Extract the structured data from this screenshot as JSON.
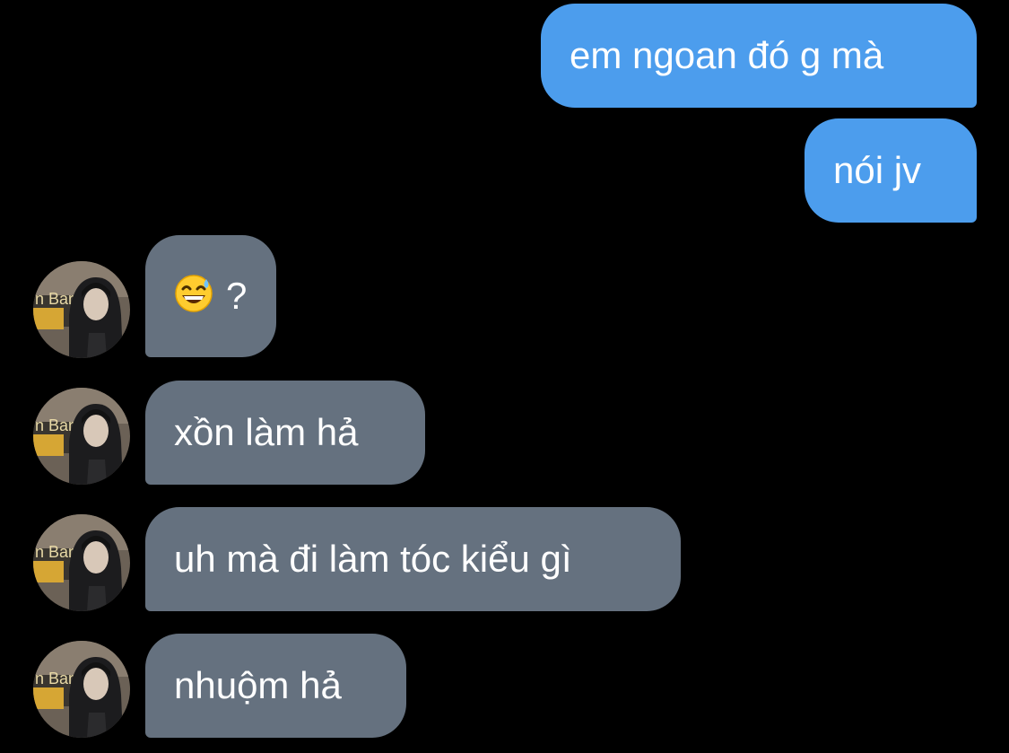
{
  "conversation": {
    "messages": [
      {
        "from": "me",
        "text": "em ngoan đó g mà"
      },
      {
        "from": "me",
        "text": "nói jv"
      },
      {
        "from": "contact",
        "emoji": "sweat-smile-emoji",
        "text": "?"
      },
      {
        "from": "contact",
        "text": "xồn làm hả"
      },
      {
        "from": "contact",
        "text": "uh mà đi làm tóc kiểu gì"
      },
      {
        "from": "contact",
        "text": "nhuộm hả"
      }
    ],
    "avatar_sign_text": "n Bar MA"
  },
  "colors": {
    "background": "#000000",
    "sent_bubble": "#4c9ded",
    "received_bubble": "#65717f",
    "text": "#ffffff"
  }
}
